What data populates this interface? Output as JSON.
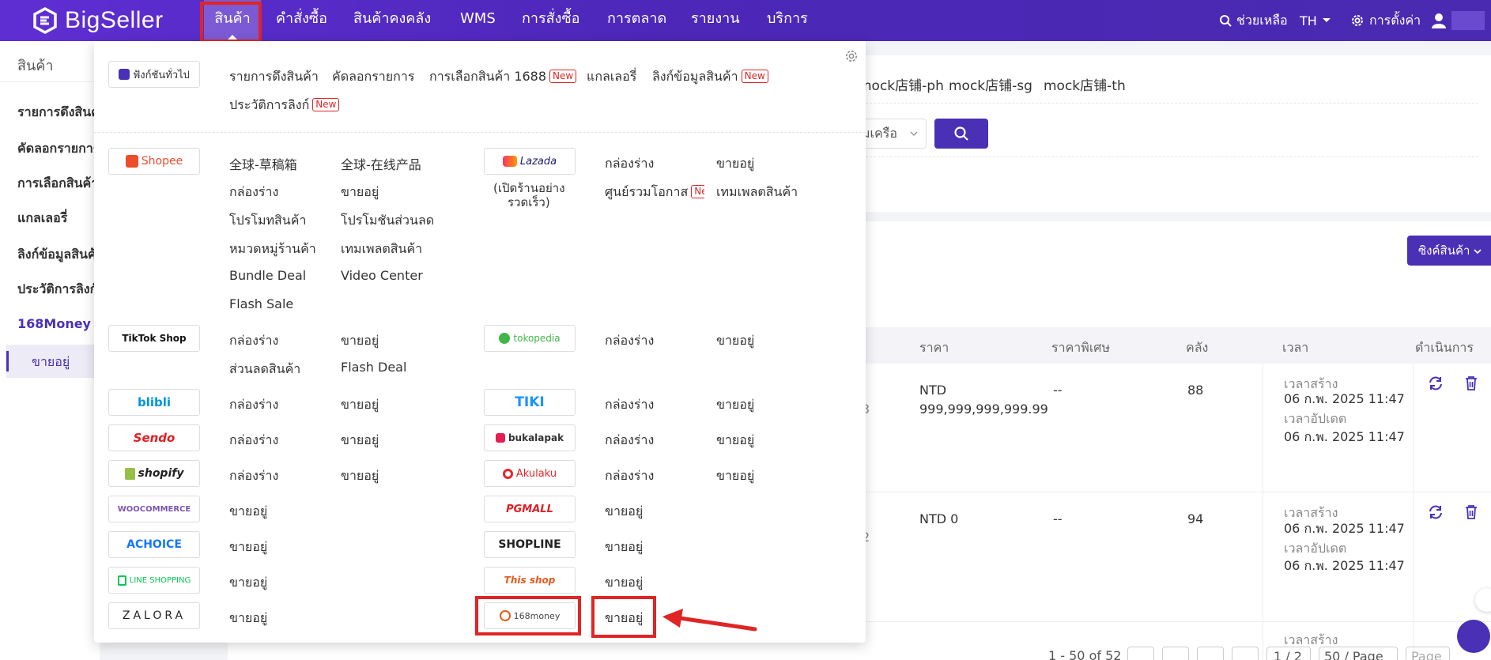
{
  "app": {
    "brand": "BigSeller"
  },
  "nav": {
    "items": [
      "สินค้า",
      "คำสั่งซื้อ",
      "สินค้าคงคลัง",
      "WMS",
      "การสั่งซื้อ",
      "การตลาด",
      "รายงาน",
      "บริการ"
    ],
    "help": "ช่วยเหลือ",
    "lang": "TH",
    "settings": "การตั้งค่า"
  },
  "sidebar": {
    "title": "สินค้า",
    "items": [
      "รายการดึงสินค้า",
      "คัดลอกรายการ",
      "การเลือกสินค้า",
      "แกลเลอรี่",
      "ลิงก์ข้อมูลสินค้า",
      "ประวัติการลิงก์",
      "168Money"
    ],
    "sub_item": "ขายอยู่"
  },
  "main": {
    "shop_tabs": [
      "mock店铺-ph",
      "mock店铺-sg",
      "mock店铺-th"
    ],
    "select_text": "มเครือ",
    "sync_button": "ซิงค์สินค้า",
    "columns": [
      "ราคา",
      "ราคาพิเศษ",
      "คลัง",
      "เวลา",
      "ดำเนินการ"
    ],
    "rows": [
      {
        "id_tail": "3",
        "price_currency": "NTD",
        "price": "999,999,999,999.99",
        "special": "--",
        "stock": "88",
        "created_label": "เวลาสร้าง",
        "created": "06 ก.พ. 2025 11:47",
        "updated_label": "เวลาอัปเดต",
        "updated": "06 ก.พ. 2025 11:47"
      },
      {
        "id_tail": "2",
        "price_currency": "NTD",
        "price": "NTD 0",
        "special": "--",
        "stock": "94",
        "created_label": "เวลาสร้าง",
        "created": "06 ก.พ. 2025 11:47",
        "updated_label": "เวลาอัปเดต",
        "updated": "06 ก.พ. 2025 11:47"
      }
    ],
    "row3_label": "เวลาสร้าง",
    "pager": {
      "range": "1 - 50 of 52",
      "page": "1 / 2",
      "per_page": "50 / Page",
      "page_btn": "Page"
    }
  },
  "dropdown": {
    "general": {
      "button": "ฟังก์ชันทั่วไป",
      "links": [
        "รายการดึงสินค้า",
        "คัดลอกรายการ",
        "การเลือกสินค้า 1688",
        "แกลเลอรี่",
        "ลิงก์ข้อมูลสินค้า",
        "ประวัติการลิงก์"
      ],
      "new_badge": "New"
    },
    "shopee": {
      "logo": "Shopee",
      "links": [
        "全球-草稿箱",
        "全球-在线产品",
        "กล่องร่าง",
        "ขายอยู่",
        "โปรโมทสินค้า",
        "โปรโมชันส่วนลด",
        "หมวดหมู่ร้านค้า",
        "เทมเพลตสินค้า",
        "Bundle Deal",
        "Video Center",
        "Flash Sale"
      ]
    },
    "lazada": {
      "logo": "Lazada",
      "note_line1": "(เปิดร้านอย่าง",
      "note_line2": "รวดเร็ว)",
      "links": [
        "กล่องร่าง",
        "ขายอยู่",
        "ศูนย์รวมโอกาส",
        "เทมเพลตสินค้า"
      ],
      "new_badge": "New"
    },
    "tiktok": {
      "logo": "TikTok Shop",
      "links": [
        "กล่องร่าง",
        "ขายอยู่",
        "ส่วนลดสินค้า",
        "Flash Deal"
      ]
    },
    "tokopedia": {
      "logo": "tokopedia",
      "links": [
        "กล่องร่าง",
        "ขายอยู่"
      ]
    },
    "blibli": {
      "logo": "blibli",
      "links": [
        "กล่องร่าง",
        "ขายอยู่"
      ]
    },
    "tiki": {
      "logo": "TIKI",
      "links": [
        "กล่องร่าง",
        "ขายอยู่"
      ]
    },
    "sendo": {
      "logo": "Sendo",
      "links": [
        "กล่องร่าง",
        "ขายอยู่"
      ]
    },
    "bukalapak": {
      "logo": "bukalapak",
      "links": [
        "กล่องร่าง",
        "ขายอยู่"
      ]
    },
    "shopify": {
      "logo": "shopify",
      "links": [
        "กล่องร่าง",
        "ขายอยู่"
      ]
    },
    "akulaku": {
      "logo": "Akulaku",
      "links": [
        "กล่องร่าง",
        "ขายอยู่"
      ]
    },
    "woocommerce": {
      "logo": "WOOCOMMERCE",
      "links": [
        "ขายอยู่"
      ]
    },
    "pgmall": {
      "logo": "PGMALL",
      "links": [
        "ขายอยู่"
      ]
    },
    "achoice": {
      "logo": "ACHOICE",
      "links": [
        "ขายอยู่"
      ]
    },
    "shopline": {
      "logo": "SHOPLINE",
      "links": [
        "ขายอยู่"
      ]
    },
    "lineshopping": {
      "logo": "LINE SHOPPING",
      "links": [
        "ขายอยู่"
      ]
    },
    "thisshop": {
      "logo": "This shop",
      "links": [
        "ขายอยู่"
      ]
    },
    "zalora": {
      "logo": "ZALORA",
      "links": [
        "ขายอยู่"
      ]
    },
    "money168": {
      "logo": "168money",
      "links": [
        "ขายอยู่"
      ]
    }
  },
  "colors": {
    "brand": "#4a30b5",
    "highlight": "#e02525"
  }
}
